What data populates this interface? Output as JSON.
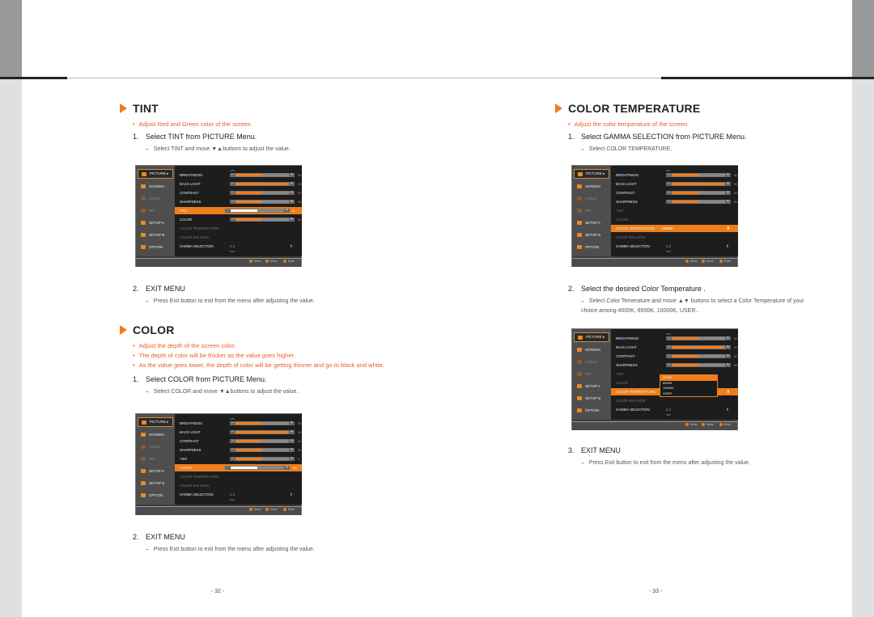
{
  "left": {
    "tint": {
      "title": "TINT",
      "bullets": [
        "Adjust Red and Green color of the screen."
      ],
      "step1": {
        "num": "1.",
        "text": "Select TINT from PICTURE Menu.",
        "sub": "Select TINT and move ▼▲buttons to adjust the value."
      },
      "step2": {
        "num": "2.",
        "text": "EXIT MENU",
        "sub": "Press Exit button to exit from the menu after adjusting the value."
      }
    },
    "color": {
      "title": "COLOR",
      "bullets": [
        "Adjust the depth of the screen color.",
        "The depth of color will be thicker as the value goes higher.",
        "As the value goes lower, the depth of color will be getting thinner and go to black and white."
      ],
      "step1": {
        "num": "1.",
        "text": "Select COLOR from PICTURE Menu.",
        "sub": "Select COLOR and move ▼▲buttons to adjust the value."
      },
      "step2": {
        "num": "2.",
        "text": "EXIT MENU",
        "sub": "Press Exit button to exit from the menu after adjusting the value."
      }
    },
    "page_number": "- 32 -"
  },
  "right": {
    "ct": {
      "title": "COLOR TEMPERATURE",
      "bullets": [
        "Adjust the color temperature of the screen."
      ],
      "step1": {
        "num": "1.",
        "text": "Select GAMMA SELECTION from PICTURE Menu.",
        "sub": "Select COLOR TEMPERATURE."
      },
      "step2": {
        "num": "2.",
        "text": "Select the desired Color Temperature .",
        "sub": "Select Color Temerature and move ▲▼ buttons to select a Color Temperature of your choice among 4000K, 6500K, 10000K, USER.."
      },
      "step3": {
        "num": "3.",
        "text": "EXIT MENU",
        "sub": "Press Exit button to exit from the menu after adjusting the value."
      }
    },
    "page_number": "- 33 -"
  },
  "osd": {
    "side": [
      "PICTURE ▸",
      "SCREEN",
      "AUDIO",
      "PIP",
      "SETUP A",
      "SETUP B",
      "OPTION"
    ],
    "items": [
      "BRIGHTNESS",
      "BACK LIGHT",
      "CONTRAST",
      "SHARPNESS",
      "TINT",
      "COLOR",
      "COLOR TEMPERATURE",
      "COLOR BALANCE",
      "GAMMA SELECTION"
    ],
    "values": {
      "brightness": "50",
      "backlight": "90",
      "contrast": "50",
      "sharpness": "50",
      "tint": "0",
      "color": "50"
    },
    "gamma": "2.2",
    "color_temp_value": "10000K",
    "dropdown": [
      "4000K",
      "6500K",
      "10000K",
      "USER"
    ],
    "footer": [
      "Menu",
      "Move",
      "Enter"
    ],
    "accent": "#ee7f1c"
  }
}
